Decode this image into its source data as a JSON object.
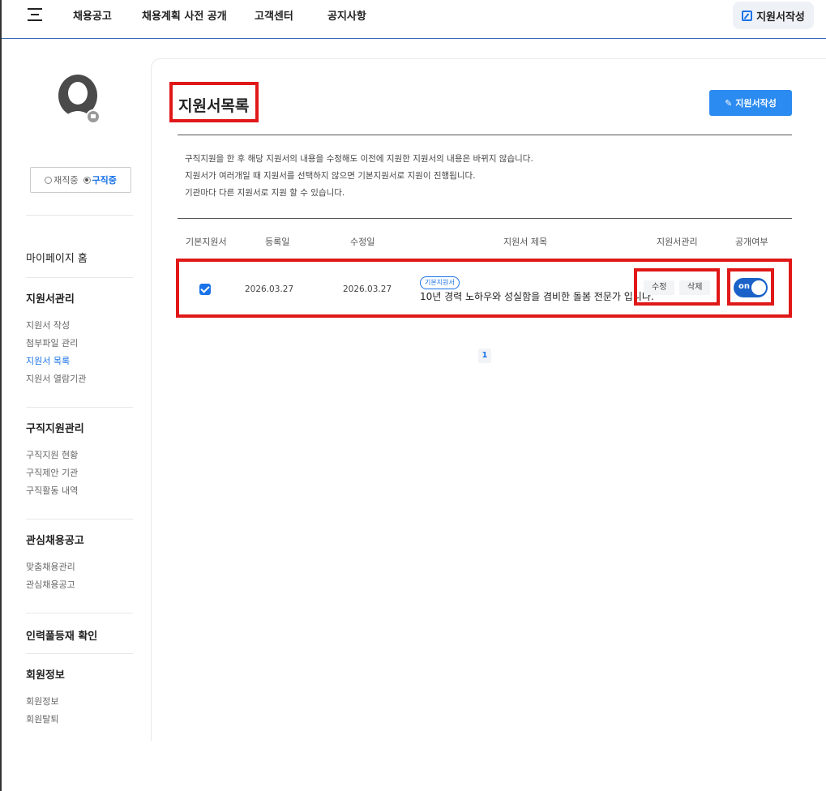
{
  "nav": {
    "items": [
      "채용공고",
      "채용계획 사전 공개",
      "고객센터",
      "공지사항"
    ],
    "write_button": "지원서작성"
  },
  "sidebar": {
    "status": {
      "option1": "재직중",
      "option2": "구직중",
      "selected": "구직중"
    },
    "mypage_home": "마이페이지 홈",
    "sections": [
      {
        "title": "지원서관리",
        "links": [
          "지원서 작성",
          "첨부파일 관리",
          "지원서 목록",
          "지원서 열람기관"
        ],
        "active": "지원서 목록"
      },
      {
        "title": "구직지원관리",
        "links": [
          "구직지원 현황",
          "구직제안 기관",
          "구직활동 내역"
        ]
      },
      {
        "title": "관심채용공고",
        "links": [
          "맞춤채용관리",
          "관심채용공고"
        ]
      },
      {
        "title": "인력풀등재 확인",
        "links": []
      },
      {
        "title": "회원정보",
        "links": [
          "회원정보",
          "회원탈퇴"
        ]
      }
    ]
  },
  "main": {
    "title": "지원서목록",
    "write_button": "지원서작성",
    "notice": [
      "구직지원을 한 후 해당 지원서의 내용을 수정해도 이전에 지원한 지원서의 내용은 바뀌지 않습니다.",
      "지원서가 여러개일 때 지원서를 선택하지 않으면 기본지원서로 지원이 진행됩니다.",
      "기관마다 다른 지원서로 지원 할 수 있습니다."
    ],
    "table": {
      "headers": [
        "기본지원서",
        "등록일",
        "수정일",
        "지원서 제목",
        "지원서관리",
        "공개여부"
      ],
      "rows": [
        {
          "is_default": true,
          "registered": "2026.03.27",
          "modified": "2026.03.27",
          "badge": "기본지원서",
          "title": "10년 경력 노하우와 성실함을 겸비한 돌봄 전문가 입니다.",
          "edit": "수정",
          "delete": "삭제",
          "public": "on"
        }
      ]
    },
    "pagination": {
      "current": "1"
    }
  },
  "colors": {
    "accent": "#1a73e8",
    "button": "#2b8bf0",
    "highlight": "#e01818"
  }
}
